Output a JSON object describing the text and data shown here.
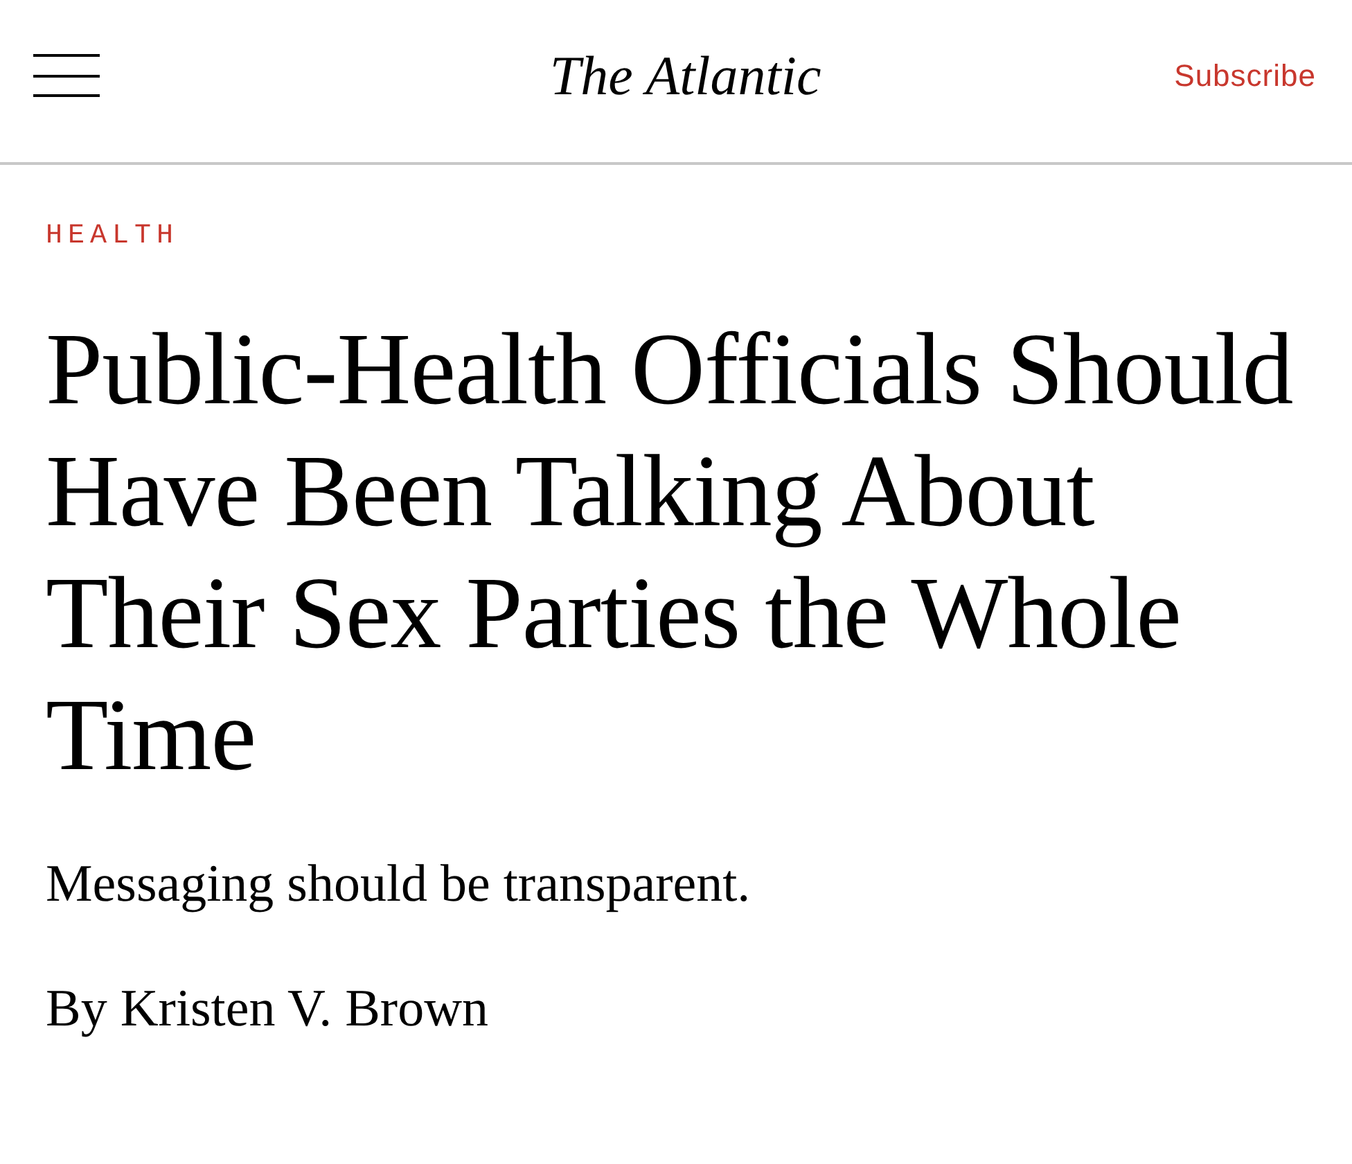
{
  "header": {
    "logo": "The Atlantic",
    "subscribe": "Subscribe"
  },
  "article": {
    "section": "HEALTH",
    "headline": "Public-Health Officials Should Have Been Talking About Their Sex Parties the Whole Time",
    "dek": "Messaging should be transparent.",
    "byline": "By Kristen V. Brown"
  }
}
